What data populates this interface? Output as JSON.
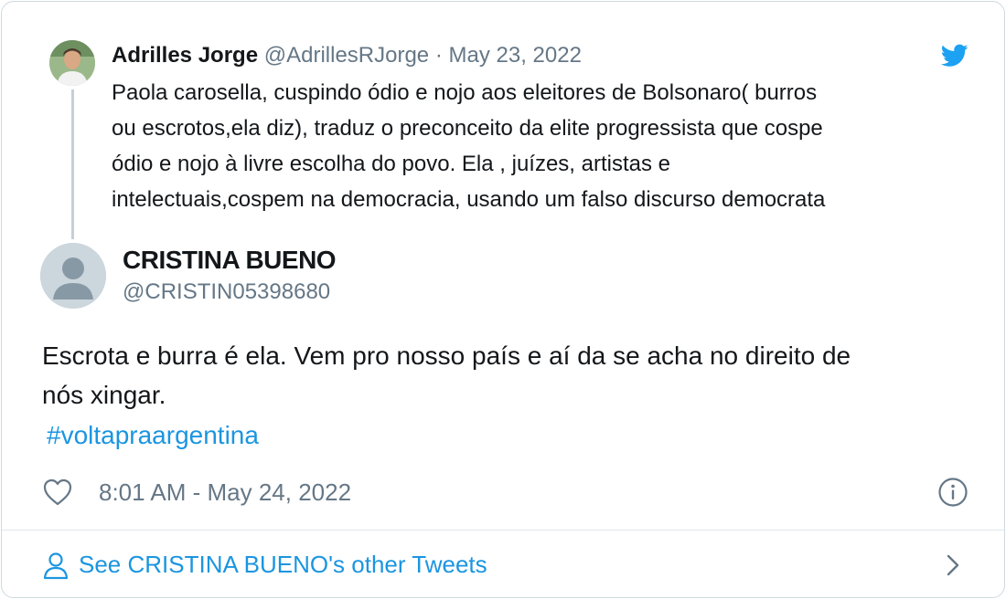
{
  "parent_tweet": {
    "author_name": "Adrilles Jorge",
    "author_handle": "@AdrillesRJorge",
    "separator": "·",
    "date": "May 23, 2022",
    "text_lines": [
      "Paola carosella, cuspindo ódio e nojo  aos eleitores de Bolsonaro( burros",
      "ou escrotos,ela diz), traduz o preconceito da elite progressista que cospe",
      "ódio e nojo à livre escolha do povo. Ela , juízes, artistas e",
      "intelectuais,cospem na democracia, usando um falso discurso democrata"
    ]
  },
  "tweet": {
    "author_name": "CRISTINA BUENO",
    "author_handle": "@CRISTIN05398680",
    "text_lines": [
      "Escrota e burra é ela. Vem pro nosso país e aí da se acha no direito de",
      "nós xingar."
    ],
    "hashtag": "#voltapraargentina",
    "timestamp": "8:01 AM - May 24, 2022"
  },
  "footer": {
    "link_label": "See CRISTINA BUENO's other Tweets"
  },
  "icons": {
    "brand": "twitter-bird-icon",
    "like": "heart-icon",
    "info": "info-icon",
    "profile": "user-icon",
    "chevron": "chevron-right-icon"
  },
  "colors": {
    "brand_blue": "#1da1f2",
    "link_blue": "#1b95e0",
    "secondary_text": "#657786",
    "primary_text": "#14171a",
    "border": "#cfd9de"
  }
}
